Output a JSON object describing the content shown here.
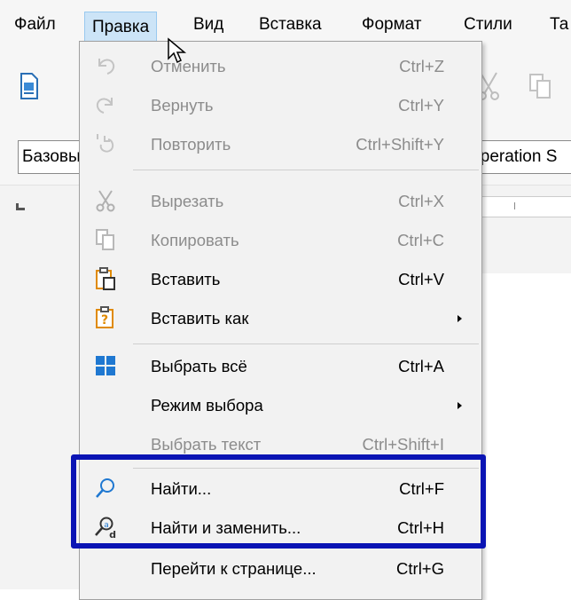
{
  "menubar": {
    "items": [
      "Файл",
      "Правка",
      "Вид",
      "Вставка",
      "Формат",
      "Стили",
      "Та"
    ]
  },
  "toolbar": {
    "style_value": "Базовый",
    "font_value": "Operation S"
  },
  "edit_menu": {
    "items": [
      {
        "label": "Отменить",
        "shortcut": "Ctrl+Z",
        "icon": "undo-icon",
        "enabled": false
      },
      {
        "label": "Вернуть",
        "shortcut": "Ctrl+Y",
        "icon": "redo-icon",
        "enabled": false
      },
      {
        "label": "Повторить",
        "shortcut": "Ctrl+Shift+Y",
        "icon": "repeat-icon",
        "enabled": false
      },
      {
        "label": "Вырезать",
        "shortcut": "Ctrl+X",
        "icon": "cut-icon",
        "enabled": false
      },
      {
        "label": "Копировать",
        "shortcut": "Ctrl+C",
        "icon": "copy-icon",
        "enabled": false
      },
      {
        "label": "Вставить",
        "shortcut": "Ctrl+V",
        "icon": "paste-icon",
        "enabled": true
      },
      {
        "label": "Вставить как",
        "shortcut": "",
        "icon": "paste-special-icon",
        "enabled": true,
        "submenu": true
      },
      {
        "label": "Выбрать всё",
        "shortcut": "Ctrl+A",
        "icon": "select-all-icon",
        "enabled": true
      },
      {
        "label": "Режим выбора",
        "shortcut": "",
        "icon": "",
        "enabled": true,
        "submenu": true
      },
      {
        "label": "Выбрать текст",
        "shortcut": "Ctrl+Shift+I",
        "icon": "",
        "enabled": false
      },
      {
        "label": "Найти...",
        "shortcut": "Ctrl+F",
        "icon": "search-icon",
        "enabled": true
      },
      {
        "label": "Найти и заменить...",
        "shortcut": "Ctrl+H",
        "icon": "find-replace-icon",
        "enabled": true
      },
      {
        "label": "Перейти к странице...",
        "shortcut": "Ctrl+G",
        "icon": "",
        "enabled": true
      }
    ]
  },
  "colors": {
    "highlight_border": "#0a14b4",
    "menu_active_bg": "#cce4f7",
    "disabled_text": "#8c8c8c"
  }
}
